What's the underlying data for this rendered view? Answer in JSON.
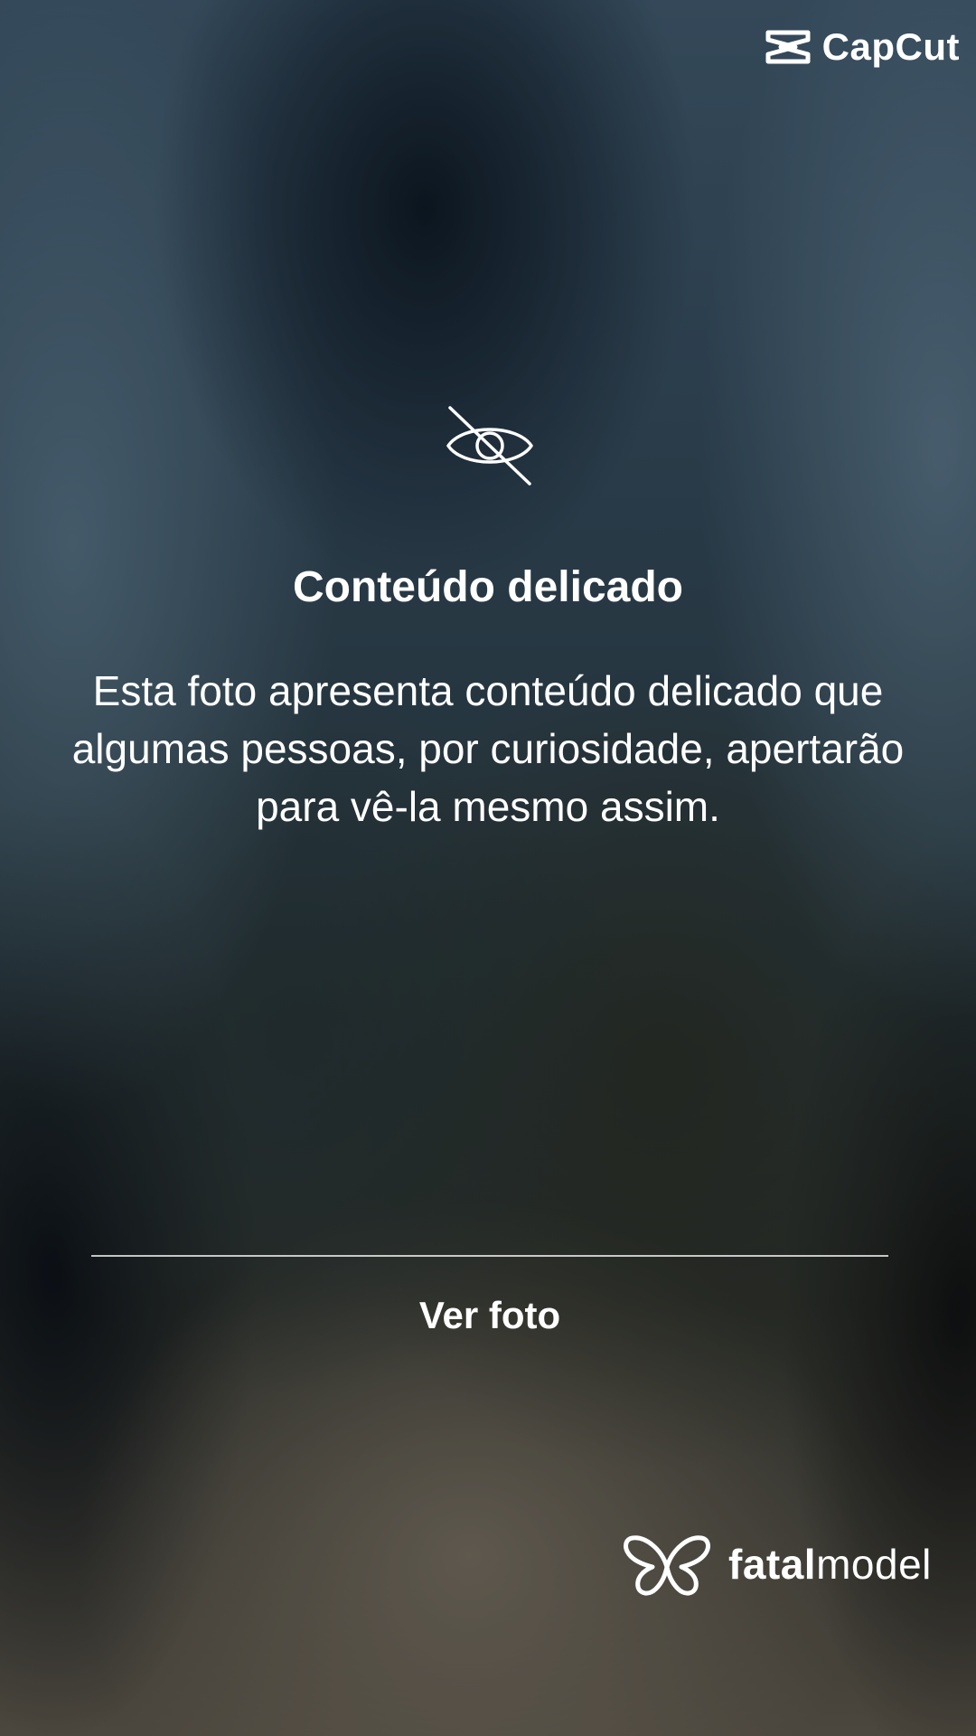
{
  "watermarks": {
    "top_right": {
      "icon": "capcut-logo-icon",
      "text": "CapCut"
    },
    "bottom_right": {
      "icon": "fatalmodel-butterfly-icon",
      "text_bold": "fatal",
      "text_regular": "model"
    }
  },
  "notice": {
    "icon": "eye-off-icon",
    "title": "Conteúdo delicado",
    "lines": [
      "Esta foto apresenta conteúdo delicado que",
      "algumas pessoas, por curiosidade, apertarão",
      "para vê-la mesmo assim."
    ],
    "button_label": "Ver foto"
  },
  "colors": {
    "text": "#ffffff",
    "divider": "#d0d6da",
    "background_dark": "#1b2530"
  }
}
